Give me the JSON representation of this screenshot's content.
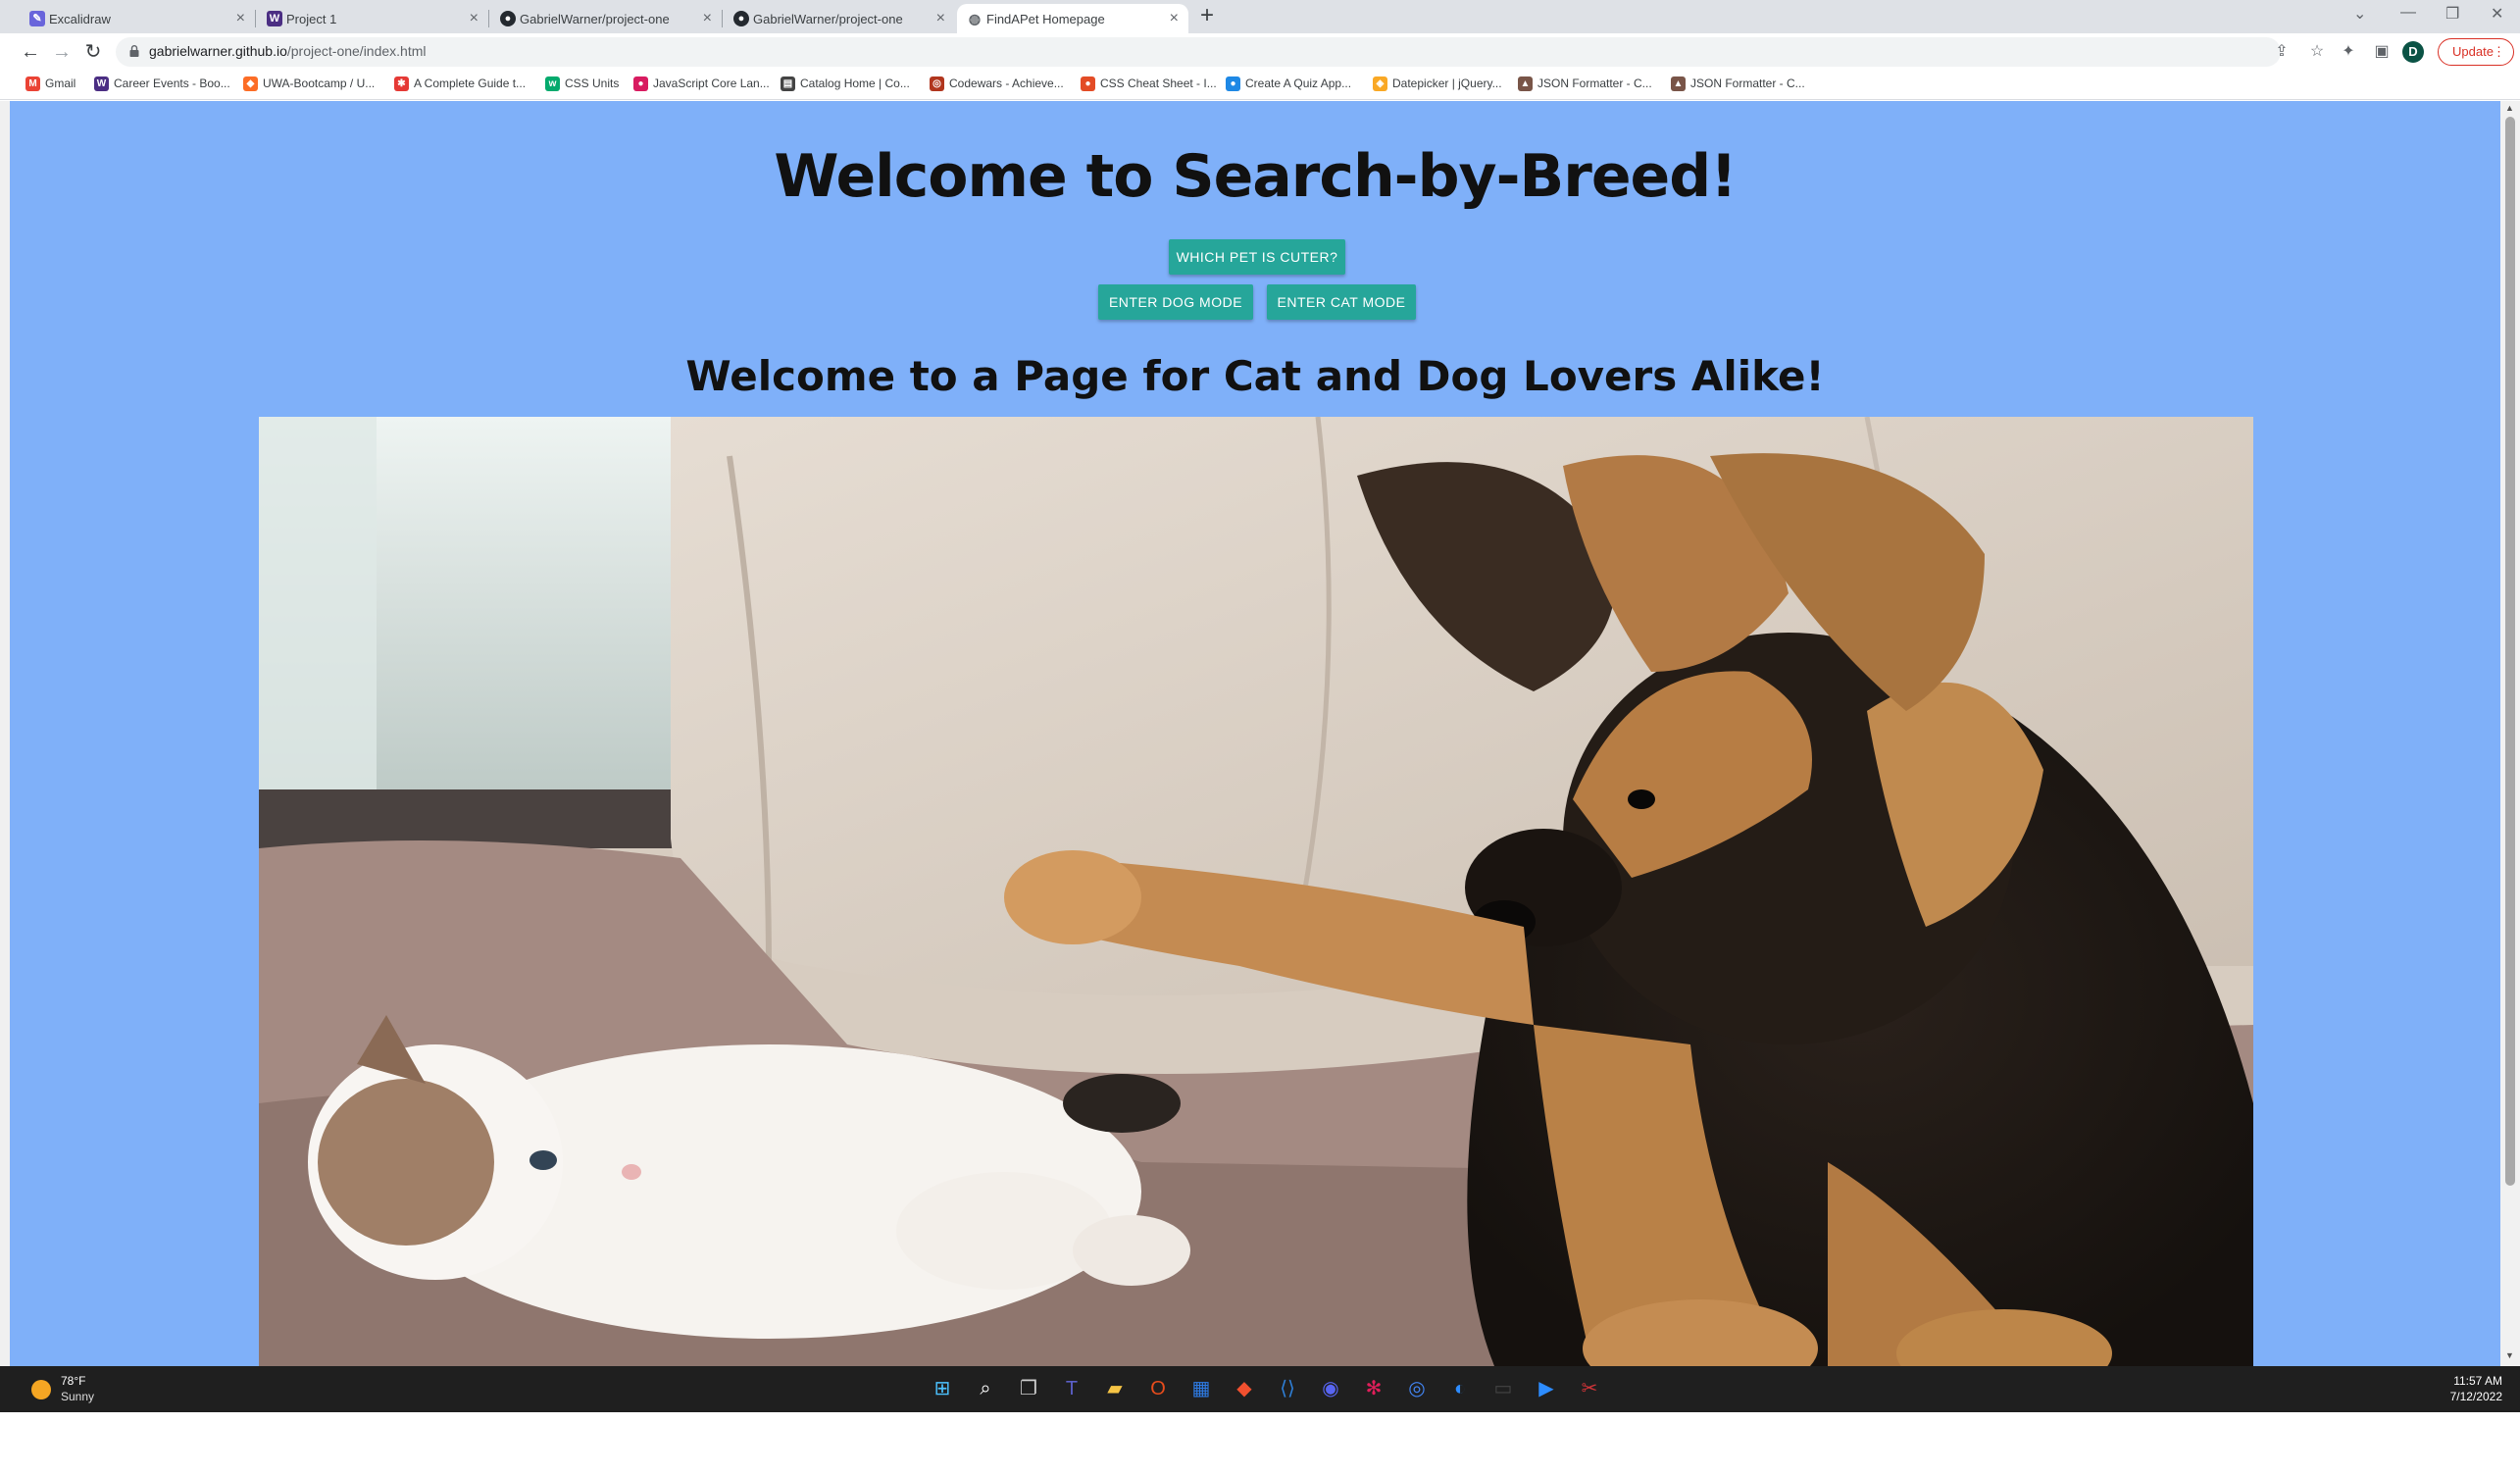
{
  "browser": {
    "tabs": [
      {
        "title": "Excalidraw",
        "favicon": "excalidraw-icon",
        "color": "#6965db"
      },
      {
        "title": "Project 1",
        "favicon": "w-logo-icon",
        "color": "#4b2e83"
      },
      {
        "title": "GabrielWarner/project-one",
        "favicon": "github-icon",
        "color": "#24292f"
      },
      {
        "title": "GabrielWarner/project-one",
        "favicon": "github-icon",
        "color": "#24292f"
      },
      {
        "title": "FindAPet Homepage",
        "favicon": "globe-icon",
        "color": "#5f6368"
      }
    ],
    "url_host": "gabrielwarner.github.io",
    "url_path": "/project-one/index.html",
    "update_label": "Update",
    "profile_initial": "D",
    "bookmarks": [
      {
        "label": "Gmail",
        "icon": "gmail-icon",
        "color": "#ea4335"
      },
      {
        "label": "Career Events - Boo...",
        "icon": "w-logo-icon",
        "color": "#4b2e83"
      },
      {
        "label": "UWA-Bootcamp / U...",
        "icon": "gitlab-icon",
        "color": "#fc6d26"
      },
      {
        "label": "A Complete Guide t...",
        "icon": "asterisk-icon",
        "color": "#e53935"
      },
      {
        "label": "CSS Units",
        "icon": "w3-icon",
        "color": "#04aa6d"
      },
      {
        "label": "JavaScript Core Lan...",
        "icon": "js-icon",
        "color": "#d81b60"
      },
      {
        "label": "Catalog Home | Co...",
        "icon": "catalog-icon",
        "color": "#444444"
      },
      {
        "label": "Codewars - Achieve...",
        "icon": "codewars-icon",
        "color": "#b1361e"
      },
      {
        "label": "CSS Cheat Sheet - I...",
        "icon": "css-icon",
        "color": "#e34c26"
      },
      {
        "label": "Create A Quiz App...",
        "icon": "quiz-icon",
        "color": "#1e88e5"
      },
      {
        "label": "Datepicker | jQuery...",
        "icon": "shield-icon",
        "color": "#f9a825"
      },
      {
        "label": "JSON Formatter - C...",
        "icon": "json-icon",
        "color": "#795548"
      },
      {
        "label": "JSON Formatter - C...",
        "icon": "json-icon",
        "color": "#795548"
      }
    ]
  },
  "page": {
    "heading": "Welcome to Search-by-Breed!",
    "cuter_button": "Which pet is cuter?",
    "dog_mode_button": "Enter Dog Mode",
    "cat_mode_button": "Enter Cat Mode",
    "subheading": "Welcome to a Page for Cat and Dog Lovers Alike!",
    "background_color": "#7fb0f9",
    "button_color": "#26a69a"
  },
  "taskbar": {
    "weather_temp": "78°F",
    "weather_desc": "Sunny",
    "time": "11:57 AM",
    "date": "7/12/2022",
    "apps": [
      "start-icon",
      "search-icon",
      "task-view-icon",
      "teams-icon",
      "file-explorer-icon",
      "office-icon",
      "store-icon",
      "git-icon",
      "vscode-icon",
      "discord-icon",
      "slack-icon",
      "chrome-icon",
      "zoom-icon",
      "terminal-icon",
      "zoom-meetings-icon",
      "snipping-tool-icon"
    ]
  }
}
